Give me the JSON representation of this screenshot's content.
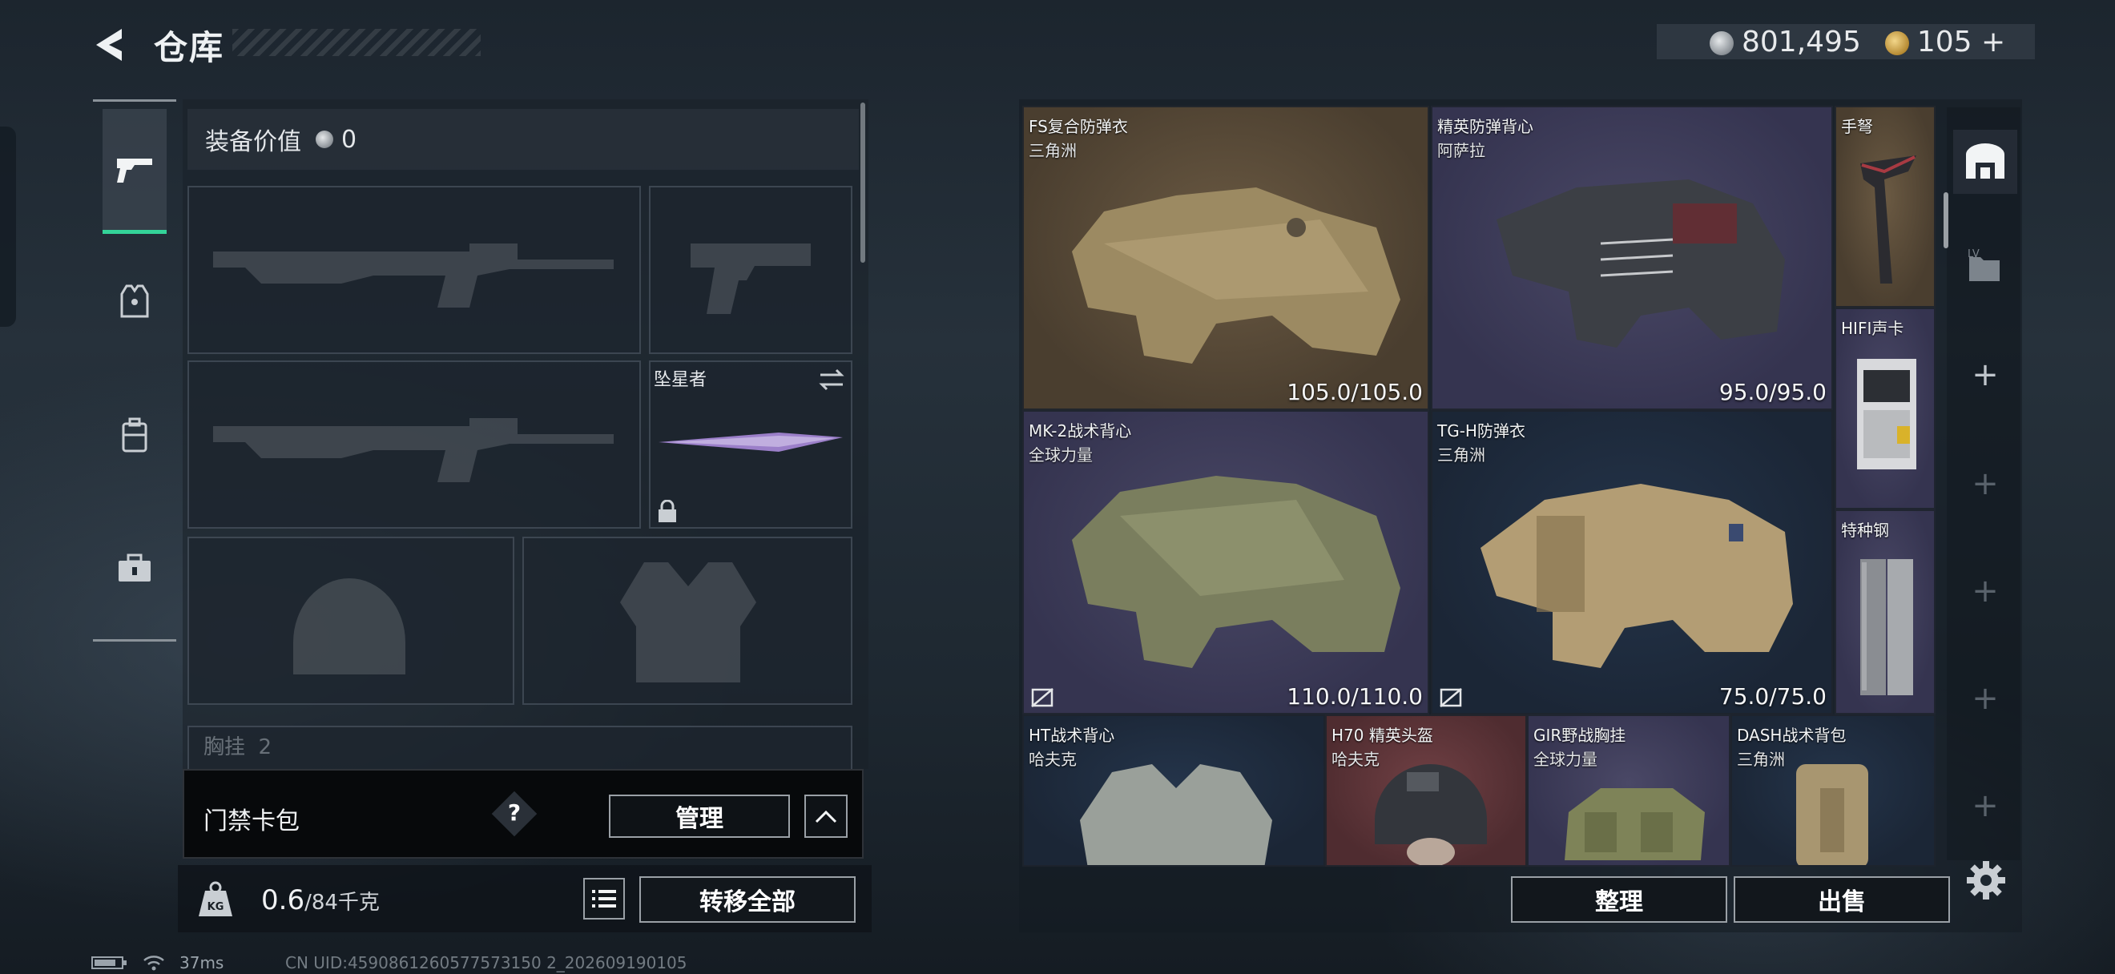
{
  "header": {
    "title": "仓库"
  },
  "currency": {
    "silver": "801,495",
    "gold": "105",
    "gold_add": "+"
  },
  "equip": {
    "value_label": "装备价值",
    "value": "0",
    "melee_name": "坠星者",
    "chest_label": "胸挂",
    "chest_count": "2",
    "card_pack_label": "门禁卡包",
    "help": "?",
    "manage_label": "管理",
    "weight": "0.6",
    "weight_max": "/84千克",
    "transfer_all_label": "转移全部"
  },
  "warehouse": {
    "items": [
      {
        "name": "FS复合防弹衣",
        "sub": "三角洲",
        "durability": "105.0/105.0",
        "rarity": "brown"
      },
      {
        "name": "精英防弹背心",
        "sub": "阿萨拉",
        "durability": "95.0/95.0",
        "rarity": "brown"
      },
      {
        "name": "手弩",
        "sub": "",
        "durability": "",
        "rarity": "brown"
      },
      {
        "name": "MK-2战术背心",
        "sub": "全球力量",
        "durability": "110.0/110.0",
        "rarity": "purple"
      },
      {
        "name": "TG-H防弹衣",
        "sub": "三角洲",
        "durability": "75.0/75.0",
        "rarity": "blue"
      },
      {
        "name": "HIFI声卡",
        "sub": "",
        "durability": "",
        "rarity": "purple"
      },
      {
        "name": "特种钢",
        "sub": "",
        "durability": "",
        "rarity": "purple"
      },
      {
        "name": "HT战术背心",
        "sub": "哈夫克",
        "durability": "",
        "rarity": "blue"
      },
      {
        "name": "H70 精英头盔",
        "sub": "哈夫克",
        "durability": "",
        "rarity": "red"
      },
      {
        "name": "GIR野战胸挂",
        "sub": "全球力量",
        "durability": "",
        "rarity": "purple"
      },
      {
        "name": "DASH战术背包",
        "sub": "三角洲",
        "durability": "",
        "rarity": "blue"
      }
    ],
    "sort_label": "整理",
    "sell_label": "出售",
    "side_tab_plus": "+"
  },
  "status": {
    "ping": "37ms",
    "uid": "CN UID:4590861260577573150 2_202609190105"
  }
}
